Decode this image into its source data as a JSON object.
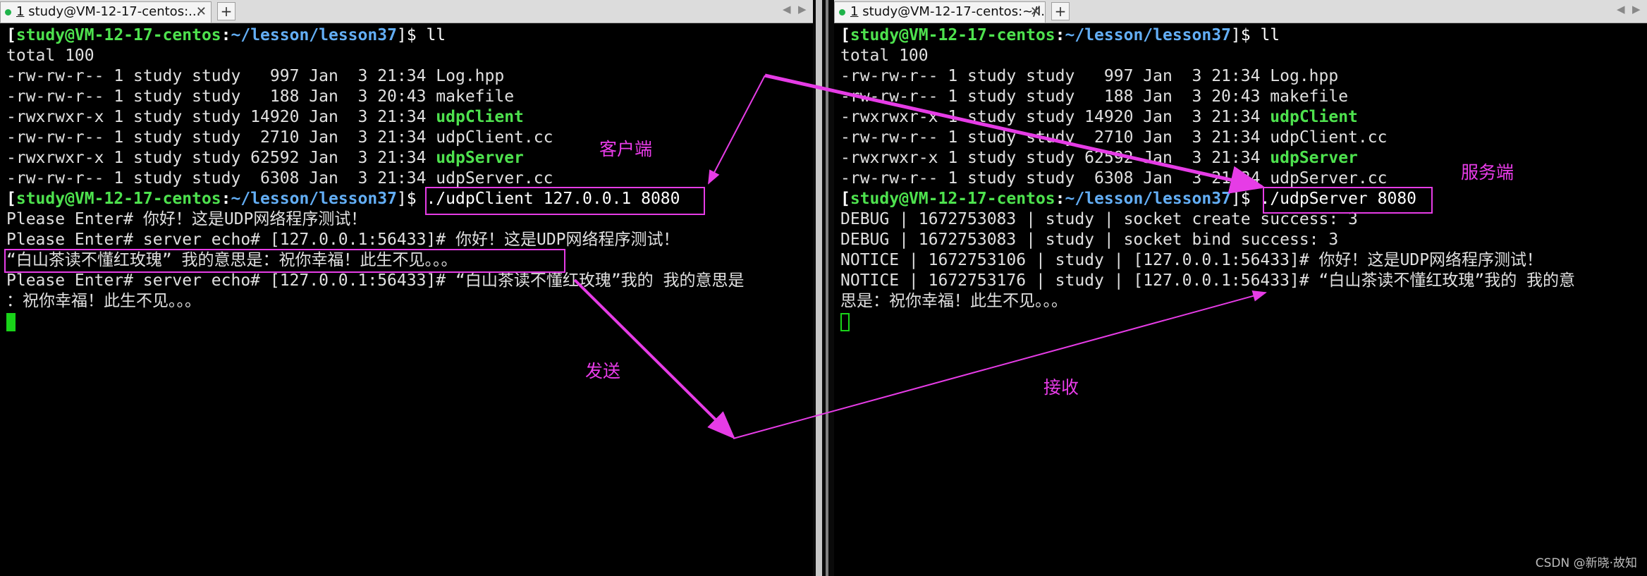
{
  "left_pane": {
    "tab_number": "1",
    "tab_title": "study@VM-12-17-centos:...",
    "lines": [
      [
        {
          "t": "[",
          "c": "wht bold"
        },
        {
          "t": "study@VM-12-17-centos",
          "c": "grn bold"
        },
        {
          "t": ":",
          "c": "wht bold"
        },
        {
          "t": "~/lesson/lesson37",
          "c": "blu bold"
        },
        {
          "t": "]$ ll",
          "c": "wht"
        }
      ],
      [
        {
          "t": "total 100",
          "c": ""
        }
      ],
      [
        {
          "t": "-rw-rw-r-- 1 study study   997 Jan  3 21:34 Log.hpp",
          "c": ""
        }
      ],
      [
        {
          "t": "-rw-rw-r-- 1 study study   188 Jan  3 20:43 makefile",
          "c": ""
        }
      ],
      [
        {
          "t": "-rwxrwxr-x 1 study study 14920 Jan  3 21:34 ",
          "c": ""
        },
        {
          "t": "udpClient",
          "c": "grn bold"
        }
      ],
      [
        {
          "t": "-rw-rw-r-- 1 study study  2710 Jan  3 21:34 udpClient.cc",
          "c": ""
        }
      ],
      [
        {
          "t": "-rwxrwxr-x 1 study study 62592 Jan  3 21:34 ",
          "c": ""
        },
        {
          "t": "udpServer",
          "c": "grn bold"
        }
      ],
      [
        {
          "t": "-rw-rw-r-- 1 study study  6308 Jan  3 21:34 udpServer.cc",
          "c": ""
        }
      ],
      [
        {
          "t": "[",
          "c": "wht bold"
        },
        {
          "t": "study@VM-12-17-centos",
          "c": "grn bold"
        },
        {
          "t": ":",
          "c": "wht bold"
        },
        {
          "t": "~/lesson/lesson37",
          "c": "blu bold"
        },
        {
          "t": "]$ ./udpClient 127.0.0.1 8080",
          "c": "wht"
        }
      ],
      [
        {
          "t": "Please Enter# 你好！这是UDP网络程序测试！",
          "c": ""
        }
      ],
      [
        {
          "t": "Please Enter# server echo# [127.0.0.1:56433]# 你好！这是UDP网络程序测试！",
          "c": ""
        }
      ],
      [
        {
          "t": "“白山茶读不懂红玫瑰” 我的意思是：祝你幸福！此生不见。。。",
          "c": ""
        }
      ],
      [
        {
          "t": "Please Enter# server echo# [127.0.0.1:56433]# “白山茶读不懂红玫瑰”我的 我的意思是",
          "c": ""
        }
      ],
      [
        {
          "t": "：祝你幸福！此生不见。。。",
          "c": ""
        }
      ]
    ]
  },
  "right_pane": {
    "tab_number": "1",
    "tab_title": "study@VM-12-17-centos:~/l...",
    "lines": [
      [
        {
          "t": "[",
          "c": "wht bold"
        },
        {
          "t": "study@VM-12-17-centos",
          "c": "grn bold"
        },
        {
          "t": ":",
          "c": "wht bold"
        },
        {
          "t": "~/lesson/lesson37",
          "c": "blu bold"
        },
        {
          "t": "]$ ll",
          "c": "wht"
        }
      ],
      [
        {
          "t": "total 100",
          "c": ""
        }
      ],
      [
        {
          "t": "-rw-rw-r-- 1 study study   997 Jan  3 21:34 Log.hpp",
          "c": ""
        }
      ],
      [
        {
          "t": "-rw-rw-r-- 1 study study   188 Jan  3 20:43 makefile",
          "c": ""
        }
      ],
      [
        {
          "t": "-rwxrwxr-x 1 study study 14920 Jan  3 21:34 ",
          "c": ""
        },
        {
          "t": "udpClient",
          "c": "grn bold"
        }
      ],
      [
        {
          "t": "-rw-rw-r-- 1 study study  2710 Jan  3 21:34 udpClient.cc",
          "c": ""
        }
      ],
      [
        {
          "t": "-rwxrwxr-x 1 study study 62592 Jan  3 21:34 ",
          "c": ""
        },
        {
          "t": "udpServer",
          "c": "grn bold"
        }
      ],
      [
        {
          "t": "-rw-rw-r-- 1 study study  6308 Jan  3 21:34 udpServer.cc",
          "c": ""
        }
      ],
      [
        {
          "t": "[",
          "c": "wht bold"
        },
        {
          "t": "study@VM-12-17-centos",
          "c": "grn bold"
        },
        {
          "t": ":",
          "c": "wht bold"
        },
        {
          "t": "~/lesson/lesson37",
          "c": "blu bold"
        },
        {
          "t": "]$ ./udpServer 8080",
          "c": "wht"
        }
      ],
      [
        {
          "t": "DEBUG | 1672753083 | study | socket create success: 3",
          "c": ""
        }
      ],
      [
        {
          "t": "DEBUG | 1672753083 | study | socket bind success: 3",
          "c": ""
        }
      ],
      [
        {
          "t": "NOTICE | 1672753106 | study | [127.0.0.1:56433]# 你好！这是UDP网络程序测试！",
          "c": ""
        }
      ],
      [
        {
          "t": "NOTICE | 1672753176 | study | [127.0.0.1:56433]# “白山茶读不懂红玫瑰”我的 我的意",
          "c": ""
        }
      ],
      [
        {
          "t": "思是：祝你幸福！此生不见。。。",
          "c": ""
        }
      ]
    ]
  },
  "annotations": {
    "client": "客户端",
    "server": "服务端",
    "send": "发送",
    "receive": "接收"
  },
  "watermark": "CSDN @新晓·故知",
  "colors": {
    "highlight": "#e63ce6",
    "prompt_user": "#4ee24e",
    "prompt_path": "#63aef5",
    "cursor": "#19d319"
  }
}
